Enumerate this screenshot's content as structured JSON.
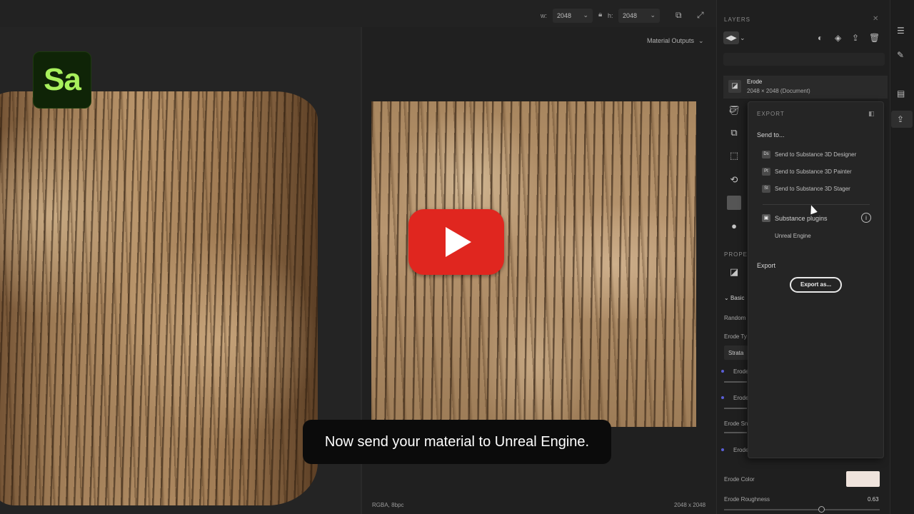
{
  "toolbar": {
    "width_label": "w:",
    "width_value": "2048",
    "lock_icon": "lock-icon",
    "height_label": "h:",
    "height_value": "2048",
    "icons": [
      "export-view-icon",
      "expand-icon"
    ]
  },
  "viewport3d": {
    "logo_text": "Sa",
    "logo_bg": "#0f2407",
    "logo_fg": "#a8f05c"
  },
  "viewport2d": {
    "material_outputs": "Material Outputs",
    "status_left": "RGBA, 8bpc",
    "status_right": "2048 x 2048"
  },
  "video": {
    "caption": "Now send your material to Unreal Engine.",
    "play_color": "#e0261f"
  },
  "layers": {
    "title": "LAYERS",
    "toolbar_icons": [
      "blend-mode-icon",
      "mask-icon",
      "fill-icon",
      "import-icon",
      "trash-icon"
    ],
    "layer": {
      "name": "Erode",
      "sub": "2048 × 2048 (Document)"
    },
    "tool_icons": [
      "paint-bucket-icon",
      "duplicate-icon",
      "transform-icon",
      "refresh-icon",
      "image-icon",
      "sphere-icon"
    ]
  },
  "properties": {
    "title": "PROPE",
    "section": "Basic",
    "random": "Random",
    "erode_type": "Erode Ty",
    "strata": "Strata",
    "erode_a": "Erode",
    "erode_b": "Erode",
    "erode_sm": "Erode Sn",
    "erode_c": "Erode",
    "erode_color": "Erode Color",
    "erode_color_value": "#efe3dc",
    "erode_roughness": "Erode Roughness",
    "erode_roughness_value": "0.63"
  },
  "export": {
    "title": "EXPORT",
    "send_to": "Send to...",
    "items": [
      {
        "icon": "Ds",
        "label": "Send to Substance 3D Designer"
      },
      {
        "icon": "Pt",
        "label": "Send to Substance 3D Painter"
      },
      {
        "icon": "St",
        "label": "Send to Substance 3D Stager"
      }
    ],
    "plugins_label": "Substance plugins",
    "unreal": "Unreal Engine",
    "export_label": "Export",
    "export_button": "Export as..."
  },
  "rail": {
    "icons": [
      "sliders-icon",
      "brush-icon",
      "document-icon",
      "share-icon"
    ]
  }
}
